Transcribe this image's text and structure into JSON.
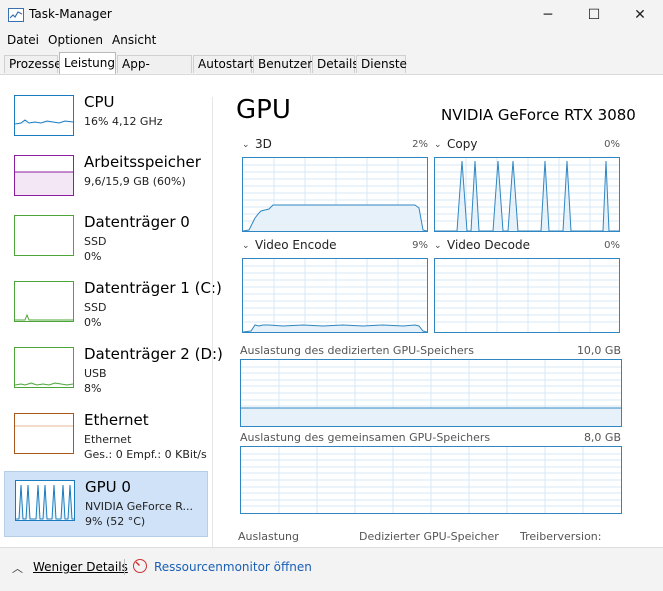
{
  "window": {
    "title": "Task-Manager",
    "minimize_glyph": "─",
    "maximize_glyph": "☐",
    "close_glyph": "✕"
  },
  "menu": [
    "Datei",
    "Optionen",
    "Ansicht"
  ],
  "tabs": [
    "Prozesse",
    "Leistung",
    "App-Verlauf",
    "Autostart",
    "Benutzer",
    "Details",
    "Dienste"
  ],
  "sidebar": [
    {
      "name": "CPU",
      "line1": "16%  4,12 GHz",
      "line2": "",
      "color": "#1a7cbf"
    },
    {
      "name": "Arbeitsspeicher",
      "line1": "9,6/15,9 GB (60%)",
      "line2": "",
      "color": "#8b1e9e"
    },
    {
      "name": "Datenträger 0",
      "line1": "SSD",
      "line2": "0%",
      "color": "#4da53a"
    },
    {
      "name": "Datenträger 1 (C:)",
      "line1": "SSD",
      "line2": "0%",
      "color": "#4da53a"
    },
    {
      "name": "Datenträger 2 (D:)",
      "line1": "USB",
      "line2": "8%",
      "color": "#4da53a"
    },
    {
      "name": "Ethernet",
      "line1": "Ethernet",
      "line2": "Ges.: 0  Empf.: 0 KBit/s",
      "color": "#a9571a"
    },
    {
      "name": "GPU 0",
      "line1": "NVIDIA GeForce R...",
      "line2": "9%  (52 °C)",
      "color": "#1a7cbf"
    }
  ],
  "detail": {
    "title": "GPU",
    "model": "NVIDIA GeForce RTX 3080",
    "engines": [
      {
        "label": "3D",
        "pct": "2%"
      },
      {
        "label": "Copy",
        "pct": "0%"
      },
      {
        "label": "Video Encode",
        "pct": "9%"
      },
      {
        "label": "Video Decode",
        "pct": "0%"
      }
    ],
    "dedicated_label": "Auslastung des dedizierten GPU-Speichers",
    "dedicated_max": "10,0 GB",
    "shared_label": "Auslastung des gemeinsamen GPU-Speichers",
    "shared_max": "8,0 GB",
    "bottom": [
      "Auslastung",
      "Dedizierter GPU-Speicher",
      "Treiberversion:"
    ]
  },
  "footer": {
    "fewer_details": "Weniger Details",
    "resource_monitor": "Ressourcenmonitor öffnen"
  },
  "colors": {
    "gpu_graph": "#2f86c2",
    "fill": "#e6f1fa",
    "selected": "#cfe2f7"
  }
}
